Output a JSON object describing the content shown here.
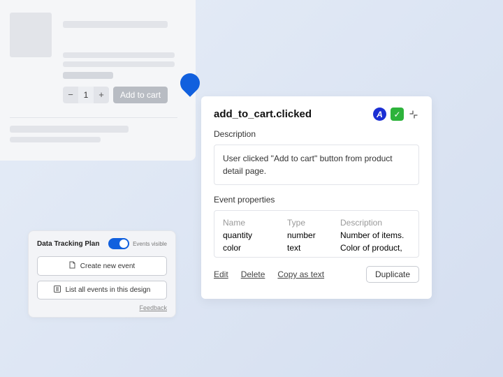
{
  "mock": {
    "qty_minus": "−",
    "qty_value": "1",
    "qty_plus": "+",
    "add_to_cart_label": "Add to cart"
  },
  "panel": {
    "event_name": "add_to_cart.clicked",
    "badge_a": "A",
    "badge_check": "✓",
    "desc_label": "Description",
    "desc_text": "User clicked \"Add to cart\" button from product detail page.",
    "props_label": "Event properties",
    "props_headers": {
      "name": "Name",
      "type": "Type",
      "desc": "Description"
    },
    "props": [
      {
        "name": "quantity",
        "type": "number",
        "desc": "Number of items."
      },
      {
        "name": "color",
        "type": "text",
        "desc": "Color of product,"
      }
    ],
    "actions": {
      "edit": "Edit",
      "delete": "Delete",
      "copy": "Copy as text",
      "duplicate": "Duplicate"
    }
  },
  "plan": {
    "title": "Data Tracking Plan",
    "toggle_label": "Events visible",
    "create_label": "Create new event",
    "list_label": "List all events in this design",
    "feedback": "Feedback"
  }
}
